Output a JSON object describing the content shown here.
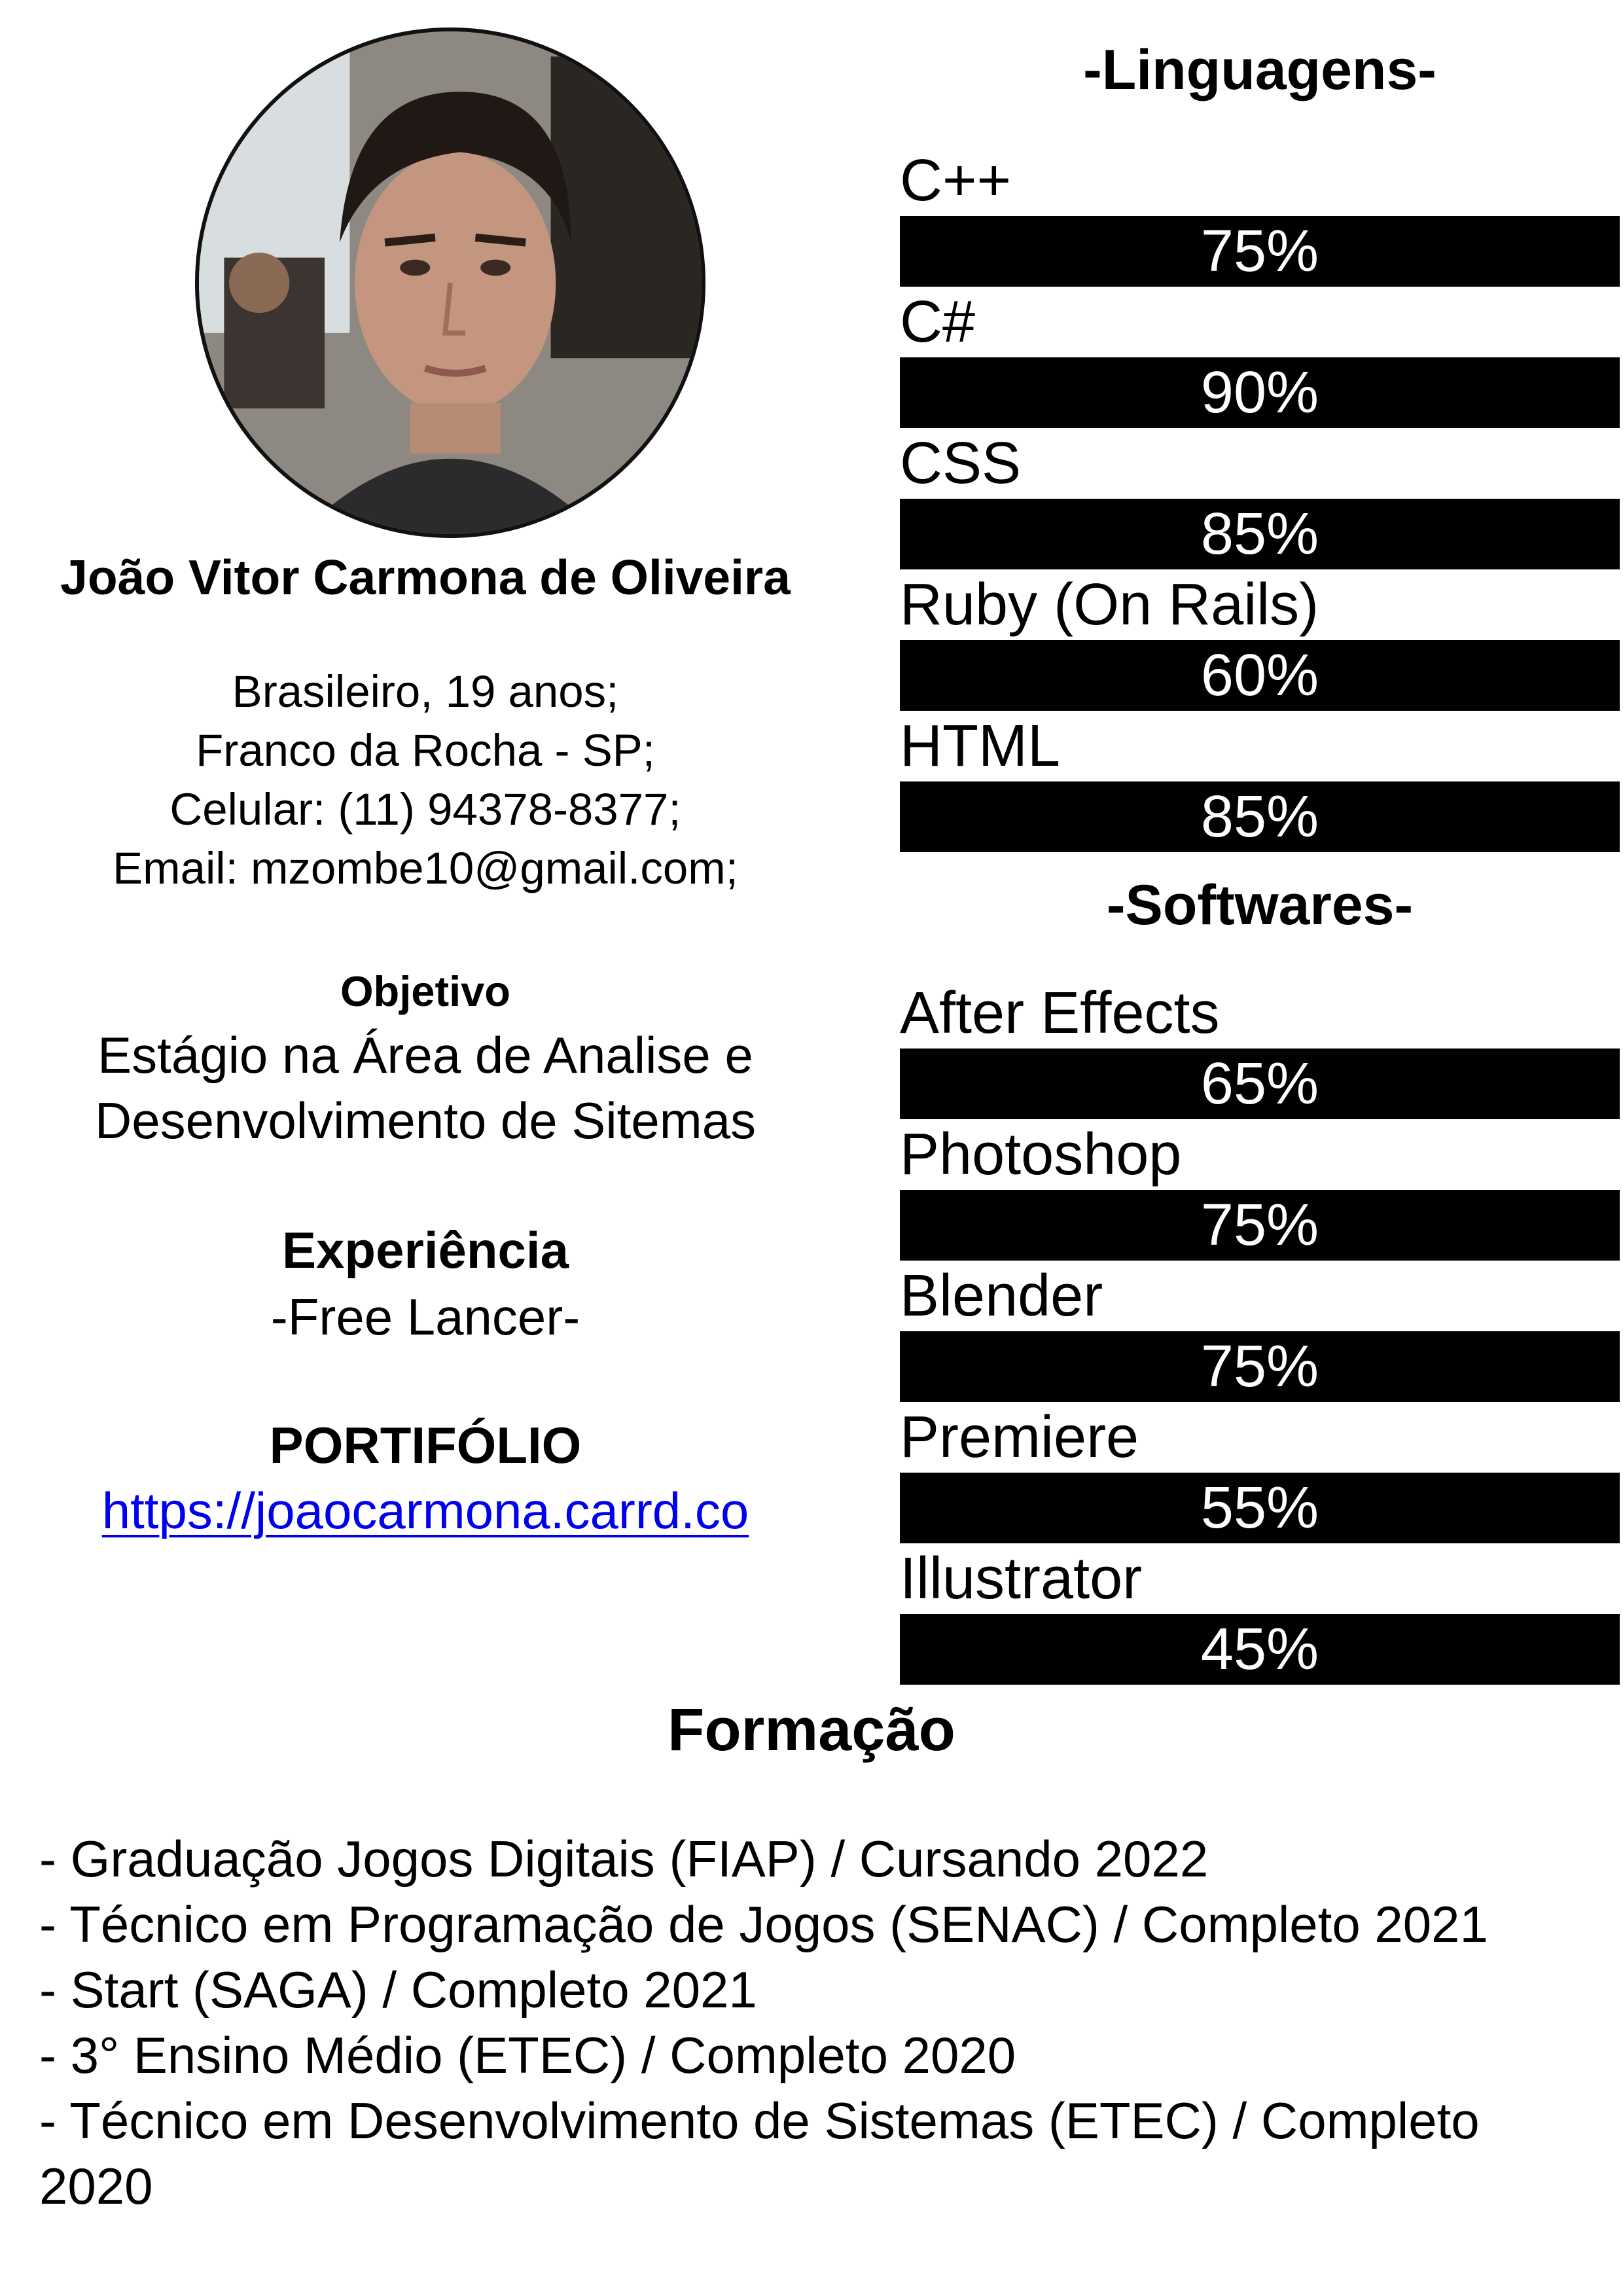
{
  "profile": {
    "name": "João Vitor Carmona de Oliveira",
    "details": [
      "Brasileiro, 19 anos;",
      "Franco da Rocha - SP;",
      "Celular: (11) 94378-8377;",
      "Email: mzombe10@gmail.com;"
    ]
  },
  "objective": {
    "title": "Objetivo",
    "lines": [
      "Estágio na Área de Analise e",
      "Desenvolvimento de Sitemas"
    ]
  },
  "experience": {
    "title": "Experiência",
    "text": "-Free Lancer-"
  },
  "portfolio": {
    "title": "PORTIFÓLIO",
    "link": "https://joaocarmona.carrd.co"
  },
  "languages": {
    "title": "-Linguagens-",
    "items": [
      {
        "name": "C++",
        "percent_label": "75%",
        "level": 1.0
      },
      {
        "name": "C#",
        "percent_label": "90%",
        "level": 1.0
      },
      {
        "name": "CSS",
        "percent_label": "85%",
        "level": 1.0
      },
      {
        "name": "Ruby (On Rails)",
        "percent_label": "60%",
        "level": 1.0
      },
      {
        "name": "HTML",
        "percent_label": "85%",
        "level": 1.0
      }
    ]
  },
  "softwares": {
    "title": "-Softwares-",
    "items": [
      {
        "name": "After Effects",
        "percent_label": "65%",
        "level": 1.0
      },
      {
        "name": "Photoshop",
        "percent_label": "75%",
        "level": 1.0
      },
      {
        "name": "Blender",
        "percent_label": "75%",
        "level": 1.0
      },
      {
        "name": "Premiere",
        "percent_label": "55%",
        "level": 1.0
      },
      {
        "name": "Illustrator",
        "percent_label": "45%",
        "level": 1.0
      }
    ]
  },
  "education": {
    "title": "Formação",
    "items": [
      "- Graduação Jogos Digitais (FIAP) / Cursando 2022",
      "- Técnico em Programação de Jogos (SENAC) / Completo 2021",
      "- Start (SAGA) / Completo 2021",
      "- 3° Ensino Médio (ETEC) / Completo 2020",
      "- Técnico em Desenvolvimento de Sistemas (ETEC) / Completo 2020"
    ]
  },
  "colors": {
    "bar": "#000000",
    "bar_text": "#ffffff",
    "link": "#0000ee"
  },
  "icons": {
    "photo": "profile-photo"
  }
}
